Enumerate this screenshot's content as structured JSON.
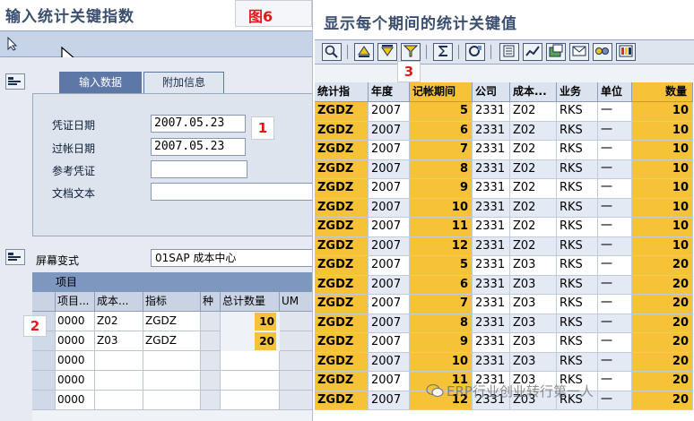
{
  "left_panel": {
    "title": "输入统计关键指数",
    "figure_label": "图6",
    "tabs": [
      "输入数据",
      "附加信息"
    ],
    "fields": [
      {
        "label": "凭证日期",
        "value": "2007.05.23"
      },
      {
        "label": "过帐日期",
        "value": "2007.05.23"
      },
      {
        "label": "参考凭证",
        "value": ""
      },
      {
        "label": "文档文本",
        "value": ""
      }
    ],
    "tag_1": "1",
    "tag_2": "2",
    "screen_variant_label": "屏幕变式",
    "screen_variant_value": "01SAP 成本中心",
    "items_header": "项目",
    "items_columns": [
      "项目...",
      "成本...",
      "指标",
      "种",
      "总计数量",
      "UM"
    ],
    "items_rows": [
      {
        "item": "0000",
        "cost": "Z02",
        "indicator": "ZGDZ",
        "qty": "10"
      },
      {
        "item": "0000",
        "cost": "Z03",
        "indicator": "ZGDZ",
        "qty": "20"
      },
      {
        "item": "0000",
        "cost": "",
        "indicator": "",
        "qty": ""
      },
      {
        "item": "0000",
        "cost": "",
        "indicator": "",
        "qty": ""
      },
      {
        "item": "0000",
        "cost": "",
        "indicator": "",
        "qty": ""
      }
    ]
  },
  "right_panel": {
    "title": "显示每个期间的统计关键值",
    "tag_3": "3",
    "columns": [
      "统计指",
      "年度",
      "记帐期间",
      "公司",
      "成本...",
      "业务",
      "单位",
      "数量"
    ],
    "rows": [
      {
        "indicator": "ZGDZ",
        "year": "2007",
        "period": "5",
        "company": "2331",
        "cost": "Z02",
        "business": "RKS",
        "unit": "一",
        "qty": "10"
      },
      {
        "indicator": "ZGDZ",
        "year": "2007",
        "period": "6",
        "company": "2331",
        "cost": "Z02",
        "business": "RKS",
        "unit": "一",
        "qty": "10"
      },
      {
        "indicator": "ZGDZ",
        "year": "2007",
        "period": "7",
        "company": "2331",
        "cost": "Z02",
        "business": "RKS",
        "unit": "一",
        "qty": "10"
      },
      {
        "indicator": "ZGDZ",
        "year": "2007",
        "period": "8",
        "company": "2331",
        "cost": "Z02",
        "business": "RKS",
        "unit": "一",
        "qty": "10"
      },
      {
        "indicator": "ZGDZ",
        "year": "2007",
        "period": "9",
        "company": "2331",
        "cost": "Z02",
        "business": "RKS",
        "unit": "一",
        "qty": "10"
      },
      {
        "indicator": "ZGDZ",
        "year": "2007",
        "period": "10",
        "company": "2331",
        "cost": "Z02",
        "business": "RKS",
        "unit": "一",
        "qty": "10"
      },
      {
        "indicator": "ZGDZ",
        "year": "2007",
        "period": "11",
        "company": "2331",
        "cost": "Z02",
        "business": "RKS",
        "unit": "一",
        "qty": "10"
      },
      {
        "indicator": "ZGDZ",
        "year": "2007",
        "period": "12",
        "company": "2331",
        "cost": "Z02",
        "business": "RKS",
        "unit": "一",
        "qty": "10"
      },
      {
        "indicator": "ZGDZ",
        "year": "2007",
        "period": "5",
        "company": "2331",
        "cost": "Z03",
        "business": "RKS",
        "unit": "一",
        "qty": "20"
      },
      {
        "indicator": "ZGDZ",
        "year": "2007",
        "period": "6",
        "company": "2331",
        "cost": "Z03",
        "business": "RKS",
        "unit": "一",
        "qty": "20"
      },
      {
        "indicator": "ZGDZ",
        "year": "2007",
        "period": "7",
        "company": "2331",
        "cost": "Z03",
        "business": "RKS",
        "unit": "一",
        "qty": "20"
      },
      {
        "indicator": "ZGDZ",
        "year": "2007",
        "period": "8",
        "company": "2331",
        "cost": "Z03",
        "business": "RKS",
        "unit": "一",
        "qty": "20"
      },
      {
        "indicator": "ZGDZ",
        "year": "2007",
        "period": "9",
        "company": "2331",
        "cost": "Z03",
        "business": "RKS",
        "unit": "一",
        "qty": "20"
      },
      {
        "indicator": "ZGDZ",
        "year": "2007",
        "period": "10",
        "company": "2331",
        "cost": "Z03",
        "business": "RKS",
        "unit": "一",
        "qty": "20"
      },
      {
        "indicator": "ZGDZ",
        "year": "2007",
        "period": "11",
        "company": "2331",
        "cost": "Z03",
        "business": "RKS",
        "unit": "一",
        "qty": "20"
      },
      {
        "indicator": "ZGDZ",
        "year": "2007",
        "period": "12",
        "company": "2331",
        "cost": "Z03",
        "business": "RKS",
        "unit": "一",
        "qty": "20"
      }
    ]
  },
  "toolbar_icons": [
    "detail-icon",
    "top-icon",
    "filter-icon",
    "set-filter-icon",
    "sum-icon",
    "display-icon",
    "export-icon",
    "graphic-icon",
    "local-file-icon",
    "mail-icon",
    "abc-icon",
    "layout-icon"
  ],
  "watermark": "ERP行业创业转行第一人",
  "colors": {
    "key_yellow": "#f6c338",
    "header_blue": "#7e97bf",
    "tag_red": "#e0191b",
    "title_color": "#3a4f70"
  }
}
